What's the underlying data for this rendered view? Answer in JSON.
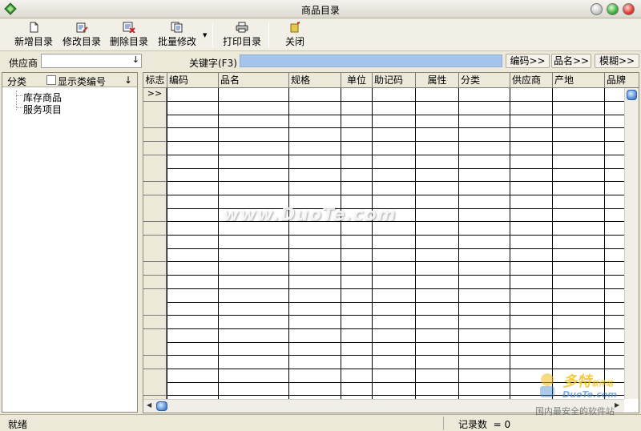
{
  "window": {
    "title": "商品目录"
  },
  "toolbar": {
    "new_label": "新增目录",
    "edit_label": "修改目录",
    "delete_label": "删除目录",
    "batch_label": "批量修改",
    "print_label": "打印目录",
    "close_label": "关闭"
  },
  "filter": {
    "supplier_label": "供应商",
    "supplier_value": "",
    "keyword_label": "关键字(F3)",
    "keyword_value": "",
    "btn_code": "编码>>",
    "btn_name": "品名>>",
    "btn_fuzzy": "模糊>>"
  },
  "left_panel": {
    "header_label": "分类",
    "show_code_label": "显示类编号",
    "show_code_checked": false,
    "tree": [
      "库存商品",
      "服务项目"
    ]
  },
  "grid": {
    "columns": [
      "标志",
      "编码",
      "品名",
      "规格",
      "单位",
      "助记码",
      "属性",
      "分类",
      "供应商",
      "产地",
      "品牌"
    ],
    "current_row_marker": ">>"
  },
  "status": {
    "left": "就绪",
    "record_count_label": "记录数",
    "record_count_value": "= 0"
  },
  "watermarks": {
    "center": "www.DuoTe.com",
    "corner_brand": "多特",
    "corner_brand_sub": "软件站",
    "corner_site": "DuoTe.com",
    "corner_slogan": "国内最安全的软件站"
  },
  "colors": {
    "keyword_box": "#a5c4ec",
    "close_button": "#e5382a",
    "max_button": "#3db13a"
  }
}
